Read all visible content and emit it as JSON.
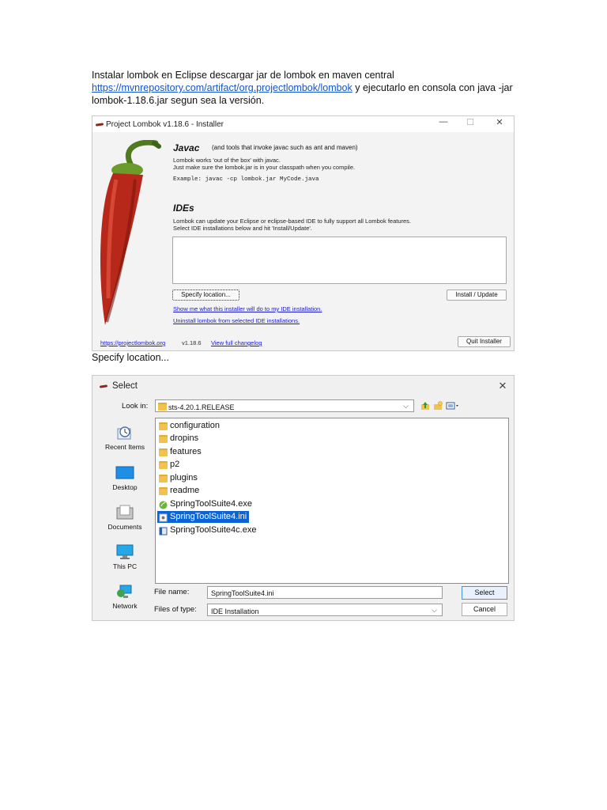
{
  "document": {
    "line1": "Instalar lombok en Eclipse descargar jar de lombok en maven central",
    "link": "https://mvnrepository.com/artifact/org.projectlombok/lombok",
    "line2_tail": " y ejecutarlo en consola con java -jar",
    "line3": "lombok-1.18.6.jar segun sea la versión.",
    "caption": "Specify location..."
  },
  "installer": {
    "title": "Project Lombok v1.18.6 - Installer",
    "controls": {
      "minimize": "—",
      "maximize": "☐",
      "close": "✕"
    },
    "javac_heading": "Javac",
    "javac_note": "(and tools that invoke javac such as ant and maven)",
    "javac_line1": "Lombok works 'out of the box' with javac.",
    "javac_line2": "Just make sure the lombok.jar is in your classpath when you compile.",
    "example": "Example: javac -cp lombok.jar MyCode.java",
    "ides_heading": "IDEs",
    "ides_line1": "Lombok can update your Eclipse or eclipse-based IDE to fully support all Lombok features.",
    "ides_line2": "Select IDE installations below and hit 'Install/Update'.",
    "specify_button": "Specify location...",
    "install_button": "Install / Update",
    "show_link": "Show me what this installer will do to my IDE installation.",
    "uninstall_link": "Uninstall lombok from selected IDE installations.",
    "site_link": "https://projectlombok.org",
    "version": "v1.18.6",
    "changelog_link": "View full changelog",
    "quit_button": "Quit Installer"
  },
  "select_dialog": {
    "title": "Select",
    "close": "✕",
    "look_in_label": "Look in:",
    "look_in_value": "sts-4.20.1.RELEASE",
    "places": [
      "Recent Items",
      "Desktop",
      "Documents",
      "This PC",
      "Network"
    ],
    "files": [
      {
        "name": "configuration",
        "kind": "folder"
      },
      {
        "name": "dropins",
        "kind": "folder"
      },
      {
        "name": "features",
        "kind": "folder"
      },
      {
        "name": "p2",
        "kind": "folder"
      },
      {
        "name": "plugins",
        "kind": "folder"
      },
      {
        "name": "readme",
        "kind": "folder"
      },
      {
        "name": "SpringToolSuite4.exe",
        "kind": "exe"
      },
      {
        "name": "SpringToolSuite4.ini",
        "kind": "ini"
      },
      {
        "name": "SpringToolSuite4c.exe",
        "kind": "console-exe"
      }
    ],
    "selected_file": "SpringToolSuite4.ini",
    "file_name_label": "File name:",
    "file_name_value": "SpringToolSuite4.ini",
    "files_of_type_label": "Files of type:",
    "files_of_type_value": "IDE Installation",
    "select_button": "Select",
    "cancel_button": "Cancel"
  }
}
